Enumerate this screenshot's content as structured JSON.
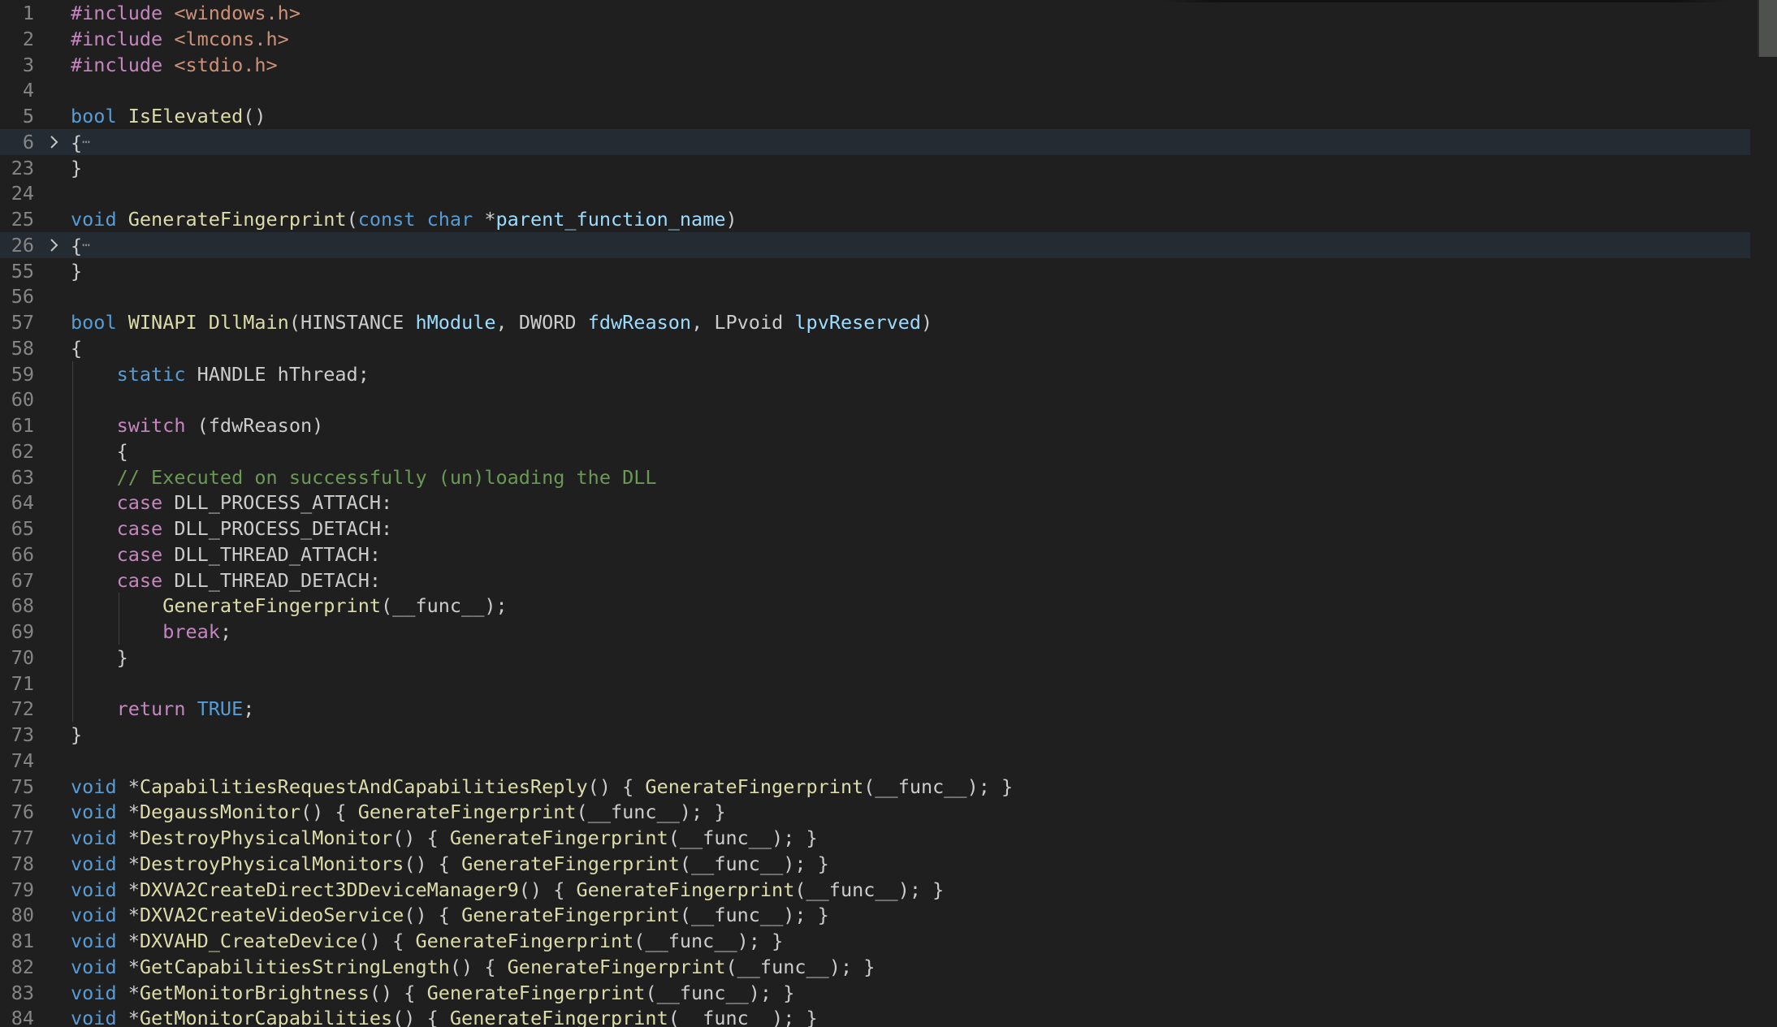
{
  "editor": {
    "language": "c",
    "lines": [
      {
        "n": "1",
        "fold": false,
        "tokens": [
          [
            "pp",
            "#include "
          ],
          [
            "str",
            "<windows.h>"
          ]
        ]
      },
      {
        "n": "2",
        "fold": false,
        "tokens": [
          [
            "pp",
            "#include "
          ],
          [
            "str",
            "<lmcons.h>"
          ]
        ]
      },
      {
        "n": "3",
        "fold": false,
        "tokens": [
          [
            "pp",
            "#include "
          ],
          [
            "str",
            "<stdio.h>"
          ]
        ]
      },
      {
        "n": "4",
        "fold": false,
        "tokens": []
      },
      {
        "n": "5",
        "fold": false,
        "tokens": [
          [
            "kw",
            "bool"
          ],
          [
            "plain",
            " "
          ],
          [
            "fn",
            "IsElevated"
          ],
          [
            "plain",
            "()"
          ]
        ]
      },
      {
        "n": "6",
        "fold": true,
        "tokens": [
          [
            "plain",
            "{"
          ],
          [
            "ell",
            "⋯"
          ]
        ]
      },
      {
        "n": "23",
        "fold": false,
        "tokens": [
          [
            "plain",
            "}"
          ]
        ]
      },
      {
        "n": "24",
        "fold": false,
        "tokens": []
      },
      {
        "n": "25",
        "fold": false,
        "tokens": [
          [
            "kw",
            "void"
          ],
          [
            "plain",
            " "
          ],
          [
            "fn",
            "GenerateFingerprint"
          ],
          [
            "plain",
            "("
          ],
          [
            "kw",
            "const"
          ],
          [
            "plain",
            " "
          ],
          [
            "kw",
            "char"
          ],
          [
            "plain",
            " *"
          ],
          [
            "param",
            "parent_function_name"
          ],
          [
            "plain",
            ")"
          ]
        ]
      },
      {
        "n": "26",
        "fold": true,
        "tokens": [
          [
            "plain",
            "{"
          ],
          [
            "ell",
            "⋯"
          ]
        ]
      },
      {
        "n": "55",
        "fold": false,
        "tokens": [
          [
            "plain",
            "}"
          ]
        ]
      },
      {
        "n": "56",
        "fold": false,
        "tokens": []
      },
      {
        "n": "57",
        "fold": false,
        "tokens": [
          [
            "kw",
            "bool"
          ],
          [
            "plain",
            " "
          ],
          [
            "fn",
            "WINAPI"
          ],
          [
            "plain",
            " "
          ],
          [
            "fn",
            "DllMain"
          ],
          [
            "plain",
            "(HINSTANCE "
          ],
          [
            "param",
            "hModule"
          ],
          [
            "plain",
            ", DWORD "
          ],
          [
            "param",
            "fdwReason"
          ],
          [
            "plain",
            ", LPvoid "
          ],
          [
            "param",
            "lpvReserved"
          ],
          [
            "plain",
            ")"
          ]
        ]
      },
      {
        "n": "58",
        "fold": false,
        "tokens": [
          [
            "plain",
            "{"
          ]
        ]
      },
      {
        "n": "59",
        "fold": false,
        "tokens": [
          [
            "plain",
            "    "
          ],
          [
            "kw",
            "static"
          ],
          [
            "plain",
            " HANDLE hThread;"
          ]
        ]
      },
      {
        "n": "60",
        "fold": false,
        "tokens": []
      },
      {
        "n": "61",
        "fold": false,
        "tokens": [
          [
            "plain",
            "    "
          ],
          [
            "ctrl",
            "switch"
          ],
          [
            "plain",
            " (fdwReason)"
          ]
        ]
      },
      {
        "n": "62",
        "fold": false,
        "tokens": [
          [
            "plain",
            "    {"
          ]
        ]
      },
      {
        "n": "63",
        "fold": false,
        "tokens": [
          [
            "plain",
            "    "
          ],
          [
            "cmt",
            "// Executed on successfully (un)loading the DLL"
          ]
        ]
      },
      {
        "n": "64",
        "fold": false,
        "tokens": [
          [
            "plain",
            "    "
          ],
          [
            "ctrl",
            "case"
          ],
          [
            "plain",
            " DLL_PROCESS_ATTACH:"
          ]
        ]
      },
      {
        "n": "65",
        "fold": false,
        "tokens": [
          [
            "plain",
            "    "
          ],
          [
            "ctrl",
            "case"
          ],
          [
            "plain",
            " DLL_PROCESS_DETACH:"
          ]
        ]
      },
      {
        "n": "66",
        "fold": false,
        "tokens": [
          [
            "plain",
            "    "
          ],
          [
            "ctrl",
            "case"
          ],
          [
            "plain",
            " DLL_THREAD_ATTACH:"
          ]
        ]
      },
      {
        "n": "67",
        "fold": false,
        "tokens": [
          [
            "plain",
            "    "
          ],
          [
            "ctrl",
            "case"
          ],
          [
            "plain",
            " DLL_THREAD_DETACH:"
          ]
        ]
      },
      {
        "n": "68",
        "fold": false,
        "tokens": [
          [
            "plain",
            "        "
          ],
          [
            "fn",
            "GenerateFingerprint"
          ],
          [
            "plain",
            "(__func__);"
          ]
        ]
      },
      {
        "n": "69",
        "fold": false,
        "tokens": [
          [
            "plain",
            "        "
          ],
          [
            "ctrl",
            "break"
          ],
          [
            "plain",
            ";"
          ]
        ]
      },
      {
        "n": "70",
        "fold": false,
        "tokens": [
          [
            "plain",
            "    }"
          ]
        ]
      },
      {
        "n": "71",
        "fold": false,
        "tokens": []
      },
      {
        "n": "72",
        "fold": false,
        "tokens": [
          [
            "plain",
            "    "
          ],
          [
            "ctrl",
            "return"
          ],
          [
            "plain",
            " "
          ],
          [
            "kw",
            "TRUE"
          ],
          [
            "plain",
            ";"
          ]
        ]
      },
      {
        "n": "73",
        "fold": false,
        "tokens": [
          [
            "plain",
            "}"
          ]
        ]
      },
      {
        "n": "74",
        "fold": false,
        "tokens": []
      },
      {
        "n": "75",
        "fold": false,
        "tokens": [
          [
            "kw",
            "void"
          ],
          [
            "plain",
            " *"
          ],
          [
            "fn",
            "CapabilitiesRequestAndCapabilitiesReply"
          ],
          [
            "plain",
            "() { "
          ],
          [
            "fn",
            "GenerateFingerprint"
          ],
          [
            "plain",
            "(__func__); }"
          ]
        ]
      },
      {
        "n": "76",
        "fold": false,
        "tokens": [
          [
            "kw",
            "void"
          ],
          [
            "plain",
            " *"
          ],
          [
            "fn",
            "DegaussMonitor"
          ],
          [
            "plain",
            "() { "
          ],
          [
            "fn",
            "GenerateFingerprint"
          ],
          [
            "plain",
            "(__func__); }"
          ]
        ]
      },
      {
        "n": "77",
        "fold": false,
        "tokens": [
          [
            "kw",
            "void"
          ],
          [
            "plain",
            " *"
          ],
          [
            "fn",
            "DestroyPhysicalMonitor"
          ],
          [
            "plain",
            "() { "
          ],
          [
            "fn",
            "GenerateFingerprint"
          ],
          [
            "plain",
            "(__func__); }"
          ]
        ]
      },
      {
        "n": "78",
        "fold": false,
        "tokens": [
          [
            "kw",
            "void"
          ],
          [
            "plain",
            " *"
          ],
          [
            "fn",
            "DestroyPhysicalMonitors"
          ],
          [
            "plain",
            "() { "
          ],
          [
            "fn",
            "GenerateFingerprint"
          ],
          [
            "plain",
            "(__func__); }"
          ]
        ]
      },
      {
        "n": "79",
        "fold": false,
        "tokens": [
          [
            "kw",
            "void"
          ],
          [
            "plain",
            " *"
          ],
          [
            "fn",
            "DXVA2CreateDirect3DDeviceManager9"
          ],
          [
            "plain",
            "() { "
          ],
          [
            "fn",
            "GenerateFingerprint"
          ],
          [
            "plain",
            "(__func__); }"
          ]
        ]
      },
      {
        "n": "80",
        "fold": false,
        "tokens": [
          [
            "kw",
            "void"
          ],
          [
            "plain",
            " *"
          ],
          [
            "fn",
            "DXVA2CreateVideoService"
          ],
          [
            "plain",
            "() { "
          ],
          [
            "fn",
            "GenerateFingerprint"
          ],
          [
            "plain",
            "(__func__); }"
          ]
        ]
      },
      {
        "n": "81",
        "fold": false,
        "tokens": [
          [
            "kw",
            "void"
          ],
          [
            "plain",
            " *"
          ],
          [
            "fn",
            "DXVAHD_CreateDevice"
          ],
          [
            "plain",
            "() { "
          ],
          [
            "fn",
            "GenerateFingerprint"
          ],
          [
            "plain",
            "(__func__); }"
          ]
        ]
      },
      {
        "n": "82",
        "fold": false,
        "tokens": [
          [
            "kw",
            "void"
          ],
          [
            "plain",
            " *"
          ],
          [
            "fn",
            "GetCapabilitiesStringLength"
          ],
          [
            "plain",
            "() { "
          ],
          [
            "fn",
            "GenerateFingerprint"
          ],
          [
            "plain",
            "(__func__); }"
          ]
        ]
      },
      {
        "n": "83",
        "fold": false,
        "tokens": [
          [
            "kw",
            "void"
          ],
          [
            "plain",
            " *"
          ],
          [
            "fn",
            "GetMonitorBrightness"
          ],
          [
            "plain",
            "() { "
          ],
          [
            "fn",
            "GenerateFingerprint"
          ],
          [
            "plain",
            "(__func__); }"
          ]
        ]
      },
      {
        "n": "84",
        "fold": false,
        "tokens": [
          [
            "kw",
            "void"
          ],
          [
            "plain",
            " *"
          ],
          [
            "fn",
            "GetMonitorCapabilities"
          ],
          [
            "plain",
            "() { "
          ],
          [
            "fn",
            "GenerateFingerprint"
          ],
          [
            "plain",
            "(__func__); }"
          ]
        ]
      }
    ],
    "colors": {
      "background": "#1f1f1f",
      "line_number": "#858585",
      "preprocessor": "#c586c0",
      "string": "#ce9178",
      "keyword": "#569cd6",
      "control": "#c586c0",
      "function": "#dcdcaa",
      "parameter": "#9cdcfe",
      "comment": "#6a9955",
      "text": "#cccccc",
      "fold_highlight": "#252b33"
    },
    "icons": {
      "fold": "chevron-right-icon"
    }
  }
}
